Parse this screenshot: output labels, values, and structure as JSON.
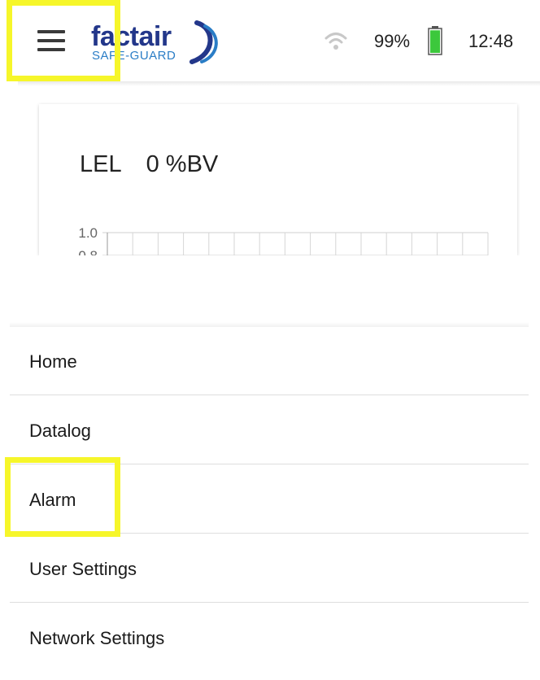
{
  "header": {
    "menu_icon": "hamburger-icon",
    "logo_text": "factair",
    "logo_sub": "SAFE-GUARD",
    "wifi_icon": "wifi-icon",
    "battery_percent": "99%",
    "battery_level": 0.99,
    "battery_icon": "battery-icon",
    "time": "12:48"
  },
  "card": {
    "gas_label": "LEL",
    "gas_value": "0 %BV"
  },
  "chart_data": {
    "type": "line",
    "y_ticks": [
      "1.0",
      "0.8"
    ],
    "ylim": [
      0,
      1.0
    ],
    "grid": true,
    "series": []
  },
  "menu": {
    "items": [
      {
        "label": "Home"
      },
      {
        "label": "Datalog"
      },
      {
        "label": "Alarm"
      },
      {
        "label": "User Settings"
      },
      {
        "label": "Network Settings"
      }
    ]
  },
  "colors": {
    "highlight": "#f6f62a",
    "brand_navy": "#23378a",
    "brand_blue": "#2a7dc6",
    "battery_green": "#3cc83c"
  }
}
